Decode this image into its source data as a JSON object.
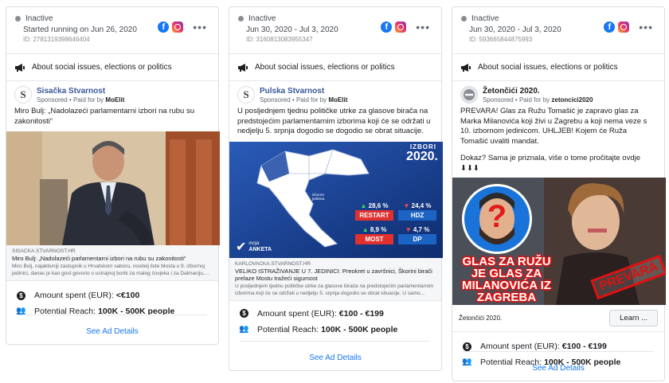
{
  "cards": [
    {
      "status": "Inactive",
      "dates": "Started running on Jun 26, 2020",
      "id": "ID: 2781319398646404",
      "category": "About social issues, elections or politics",
      "advertiser": "Sisačka Stvarnost",
      "sponsored_prefix": "Sponsored • Paid for by ",
      "payer": "MoElit",
      "ad_text": "Miro Bulj: „Nadolazeći parlamentarni izbori na rubu su zakonitosti“",
      "link": {
        "domain": "SISACKA.STVARNOST.HR",
        "title": "Miro Bulj: „Nadolazeći parlamentarni izbori na rubu su zakonitosti“",
        "desc": "Miro Bulj, najaktivniji zastupnik u Hrvatskom saboru, nositelj liste Mosta u 9. izbornoj jedinici, danas je kao gost govorio o ustrajnoj borbi za malog čovjeka i za Dalmaciju,..."
      },
      "amount_label": "Amount spent (EUR):",
      "amount_value": "<€100",
      "reach_label": "Potential Reach:",
      "reach_value": "100K - 500K people",
      "details": "See Ad Details"
    },
    {
      "status": "Inactive",
      "dates": "Jun 30, 2020 - Jul 3, 2020",
      "id": "ID: 3160813083955347",
      "category": "About social issues, elections or politics",
      "advertiser": "Pulska Stvarnost",
      "sponsored_prefix": "Sponsored • Paid for by ",
      "payer": "MoElit",
      "ad_text": "U posljednjem tjednu političke utrke za glasove birača na predstojećim parlamentarnim izborima koji će se održati u nedjelju 5. srpnja dogodio se dogodio se obrat situacije.",
      "image": {
        "year_label_top": "IZBORI",
        "year_label": "2020.",
        "district": "7.",
        "district_sub": "izborna jedinica",
        "brand_line1": "moja",
        "brand_line2": "ANKETA",
        "parties": [
          {
            "pct": "28,6 %",
            "name": "RESTART",
            "trend": "up"
          },
          {
            "pct": "24,4 %",
            "name": "HDZ",
            "trend": "down"
          },
          {
            "pct": "8,9 %",
            "name": "MOST",
            "trend": "up"
          },
          {
            "pct": "4,7 %",
            "name": "DP",
            "trend": "down"
          }
        ]
      },
      "link": {
        "domain": "KARLOVACKA.STVARNOST.HR",
        "title": "VELIKO ISTRAŽIVANJE U 7. JEDINICI: Preokret u završnici, Škorini birači prelaze Mostu tražeći sigurnost",
        "desc": "U posljednjem tjednu političke utrke za glasove birača na predstojećim parlamentarnim izborima koji će se održati u nedjelju 5. srpnja dogodio se obrat situacije. U samo..."
      },
      "amount_label": "Amount spent (EUR):",
      "amount_value": "€100 - €199",
      "reach_label": "Potential Reach:",
      "reach_value": "100K - 500K people",
      "details": "See Ad Details"
    },
    {
      "status": "Inactive",
      "dates": "Jun 30, 2020 - Jul 3, 2020",
      "id": "ID: 593665844875993",
      "category": "About social issues, elections or politics",
      "advertiser": "Žetončići 2020.",
      "sponsored_prefix": "Sponsored • Paid for by ",
      "payer": "zetoncici2020",
      "ad_text": "PREVARA! Glas za Ružu Tomašić je zapravo glas za Marka Milanovića koji živi u Zagrebu a koji nema veze s 10. izbornom jedinicom. UHLJEB! Kojem će Ruža Tomašić uvaliti mandat.",
      "ad_text2": "Dokaz? Sama je priznala, više o tome pročitajte ovdje ⬇⬇⬇",
      "image": {
        "overlay_text": "GLAS ZA RUŽU JE GLAS ZA MILANOVIĆA IZ ZAGREBA",
        "stamp": "PREVARA"
      },
      "cta_caption": "Žetončići 2020.",
      "cta_button": "Learn ...",
      "amount_label": "Amount spent (EUR):",
      "amount_value": "€100 - €199",
      "reach_label": "Potential Reach:",
      "reach_value": "100K - 500K people",
      "details": "See Ad Details"
    }
  ],
  "colors": {
    "link_blue": "#1877f2",
    "advertiser_blue": "#385898",
    "restart_red": "#e0312f",
    "party_blue": "#1c64c4"
  }
}
